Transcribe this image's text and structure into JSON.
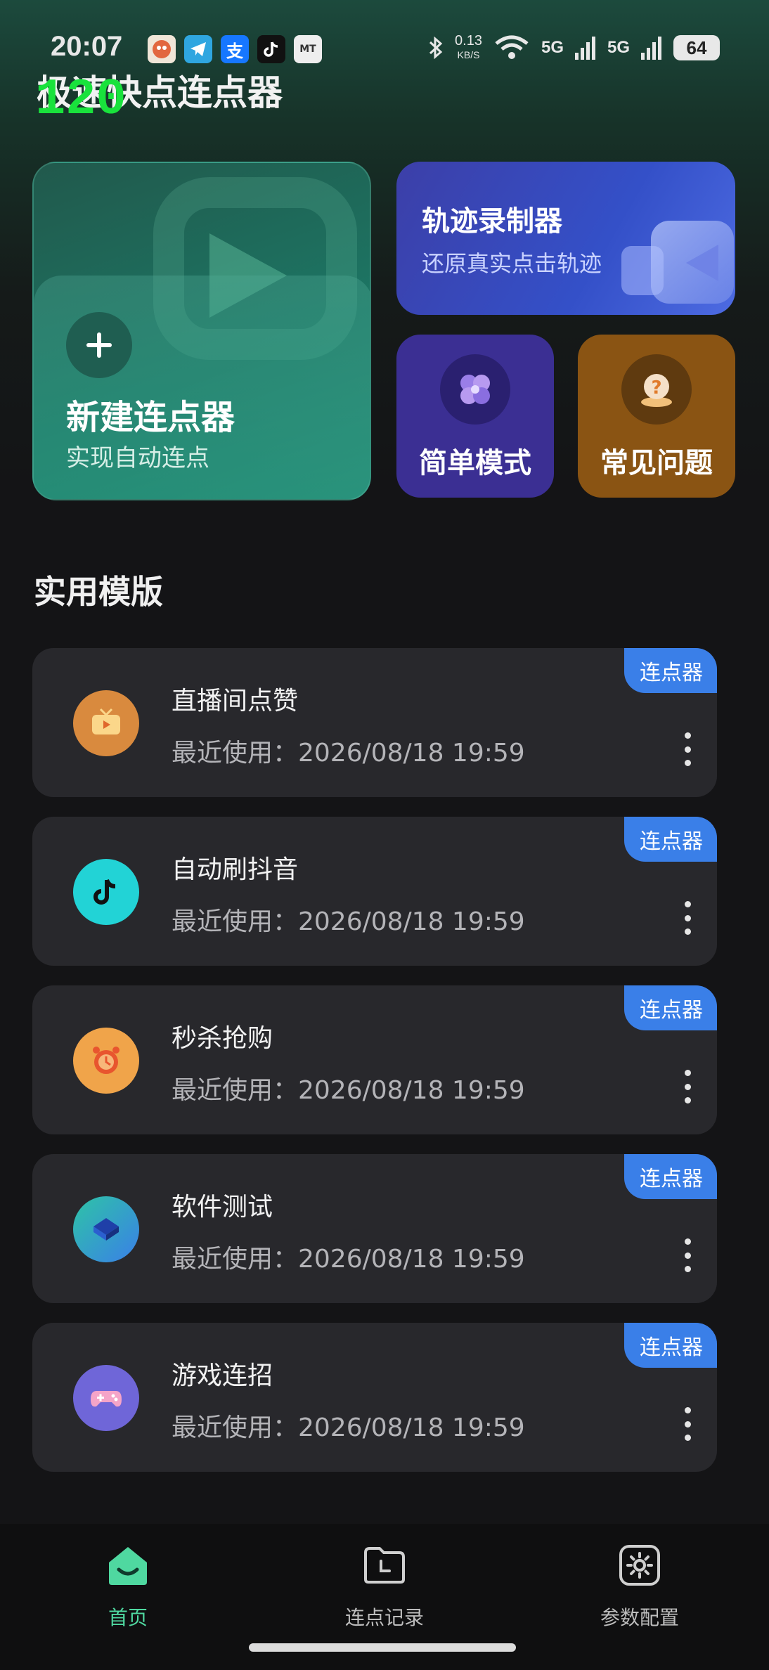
{
  "status_bar": {
    "time": "20:07",
    "notif_icons": [
      "app-icon",
      "telegram-icon",
      "alipay-icon",
      "tiktok-icon",
      "mt-icon"
    ],
    "net_speed_value": "0.13",
    "net_speed_unit": "KB/S",
    "signal1": "5G",
    "signal2": "5G",
    "battery": "64"
  },
  "fps_overlay": "120",
  "app_title": "极速快点连点器",
  "cards": {
    "new_clicker": {
      "title": "新建连点器",
      "subtitle": "实现自动连点",
      "icon": "plus-icon"
    },
    "track_recorder": {
      "title": "轨迹录制器",
      "subtitle": "还原真实点击轨迹",
      "icon": "camera-icon"
    },
    "simple_mode": {
      "title": "简单模式",
      "icon": "clover-icon"
    },
    "faq": {
      "title": "常见问题",
      "icon": "question-icon"
    }
  },
  "section_title": "实用模版",
  "templates": [
    {
      "name": "直播间点赞",
      "time_label": "最近使用：2026/08/18 19:59",
      "badge": "连点器",
      "icon": "tv-icon",
      "color": "#d98a3e"
    },
    {
      "name": "自动刷抖音",
      "time_label": "最近使用：2026/08/18 19:59",
      "badge": "连点器",
      "icon": "tiktok-icon",
      "color": "#22d3d6"
    },
    {
      "name": "秒杀抢购",
      "time_label": "最近使用：2026/08/18 19:59",
      "badge": "连点器",
      "icon": "alarm-icon",
      "color": "#f0a44a"
    },
    {
      "name": "软件测试",
      "time_label": "最近使用：2026/08/18 19:59",
      "badge": "连点器",
      "icon": "chip-icon",
      "color": "#3aa6d6"
    },
    {
      "name": "游戏连招",
      "time_label": "最近使用：2026/08/18 19:59",
      "badge": "连点器",
      "icon": "gamepad-icon",
      "color": "#8a6ee8"
    }
  ],
  "bottom_nav": [
    {
      "label": "首页",
      "icon": "home-icon",
      "active": true
    },
    {
      "label": "连点记录",
      "icon": "folder-clock-icon",
      "active": false
    },
    {
      "label": "参数配置",
      "icon": "settings-icon",
      "active": false
    }
  ],
  "colors": {
    "accent_green": "#4fd8a0",
    "badge_blue": "#3a7fe8",
    "card_green": "#1c7765",
    "card_blue": "#3450c8",
    "card_purple": "#3b2f93",
    "card_orange": "#8a5413"
  }
}
